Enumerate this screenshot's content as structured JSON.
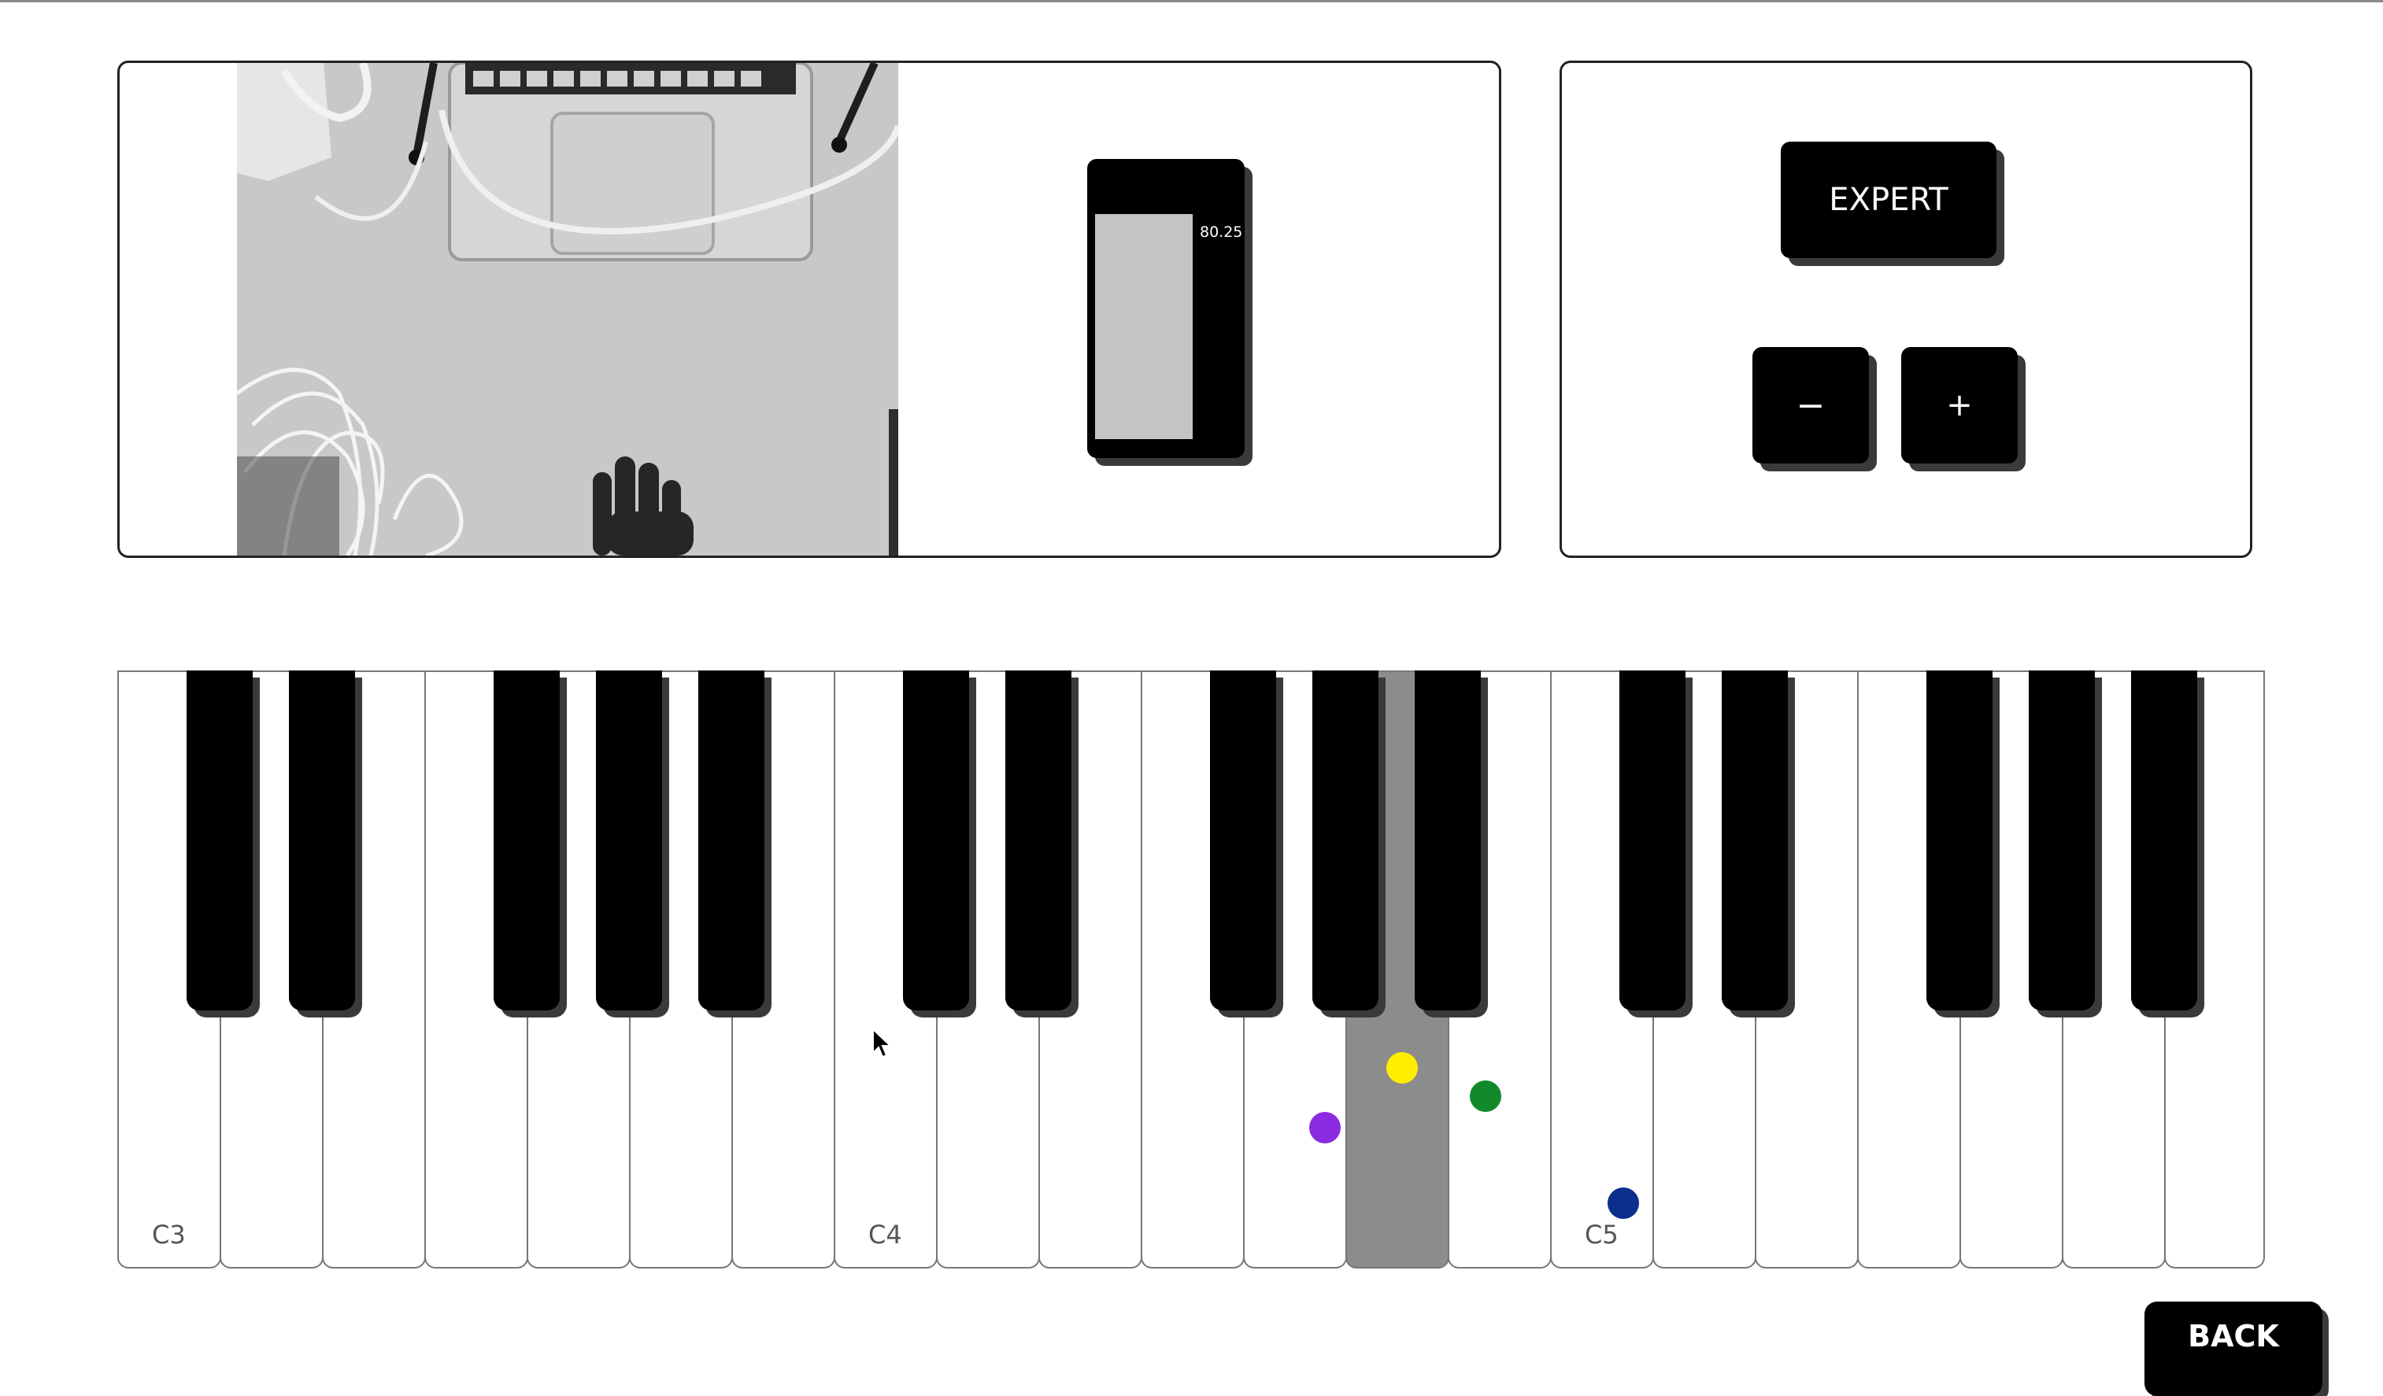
{
  "camera": {
    "label": "hand-tracking-camera-feed"
  },
  "meter": {
    "value": "80.25",
    "fill_fraction": 0.7
  },
  "controls": {
    "expert_label": "EXPERT",
    "minus_label": "−",
    "plus_label": "+"
  },
  "piano": {
    "white_key_count": 21,
    "active_white_key_index": 12,
    "octave_labels": [
      {
        "key_index": 0,
        "text": "C3"
      },
      {
        "key_index": 7,
        "text": "C4"
      },
      {
        "key_index": 14,
        "text": "C5"
      }
    ]
  },
  "finger_markers": [
    {
      "name": "purple-finger-marker",
      "color": "#8a2be2"
    },
    {
      "name": "yellow-finger-marker",
      "color": "#ffee00"
    },
    {
      "name": "green-finger-marker",
      "color": "#128a2c"
    },
    {
      "name": "blue-finger-marker",
      "color": "#0a2f8c"
    }
  ],
  "back": {
    "label": "BACK"
  }
}
